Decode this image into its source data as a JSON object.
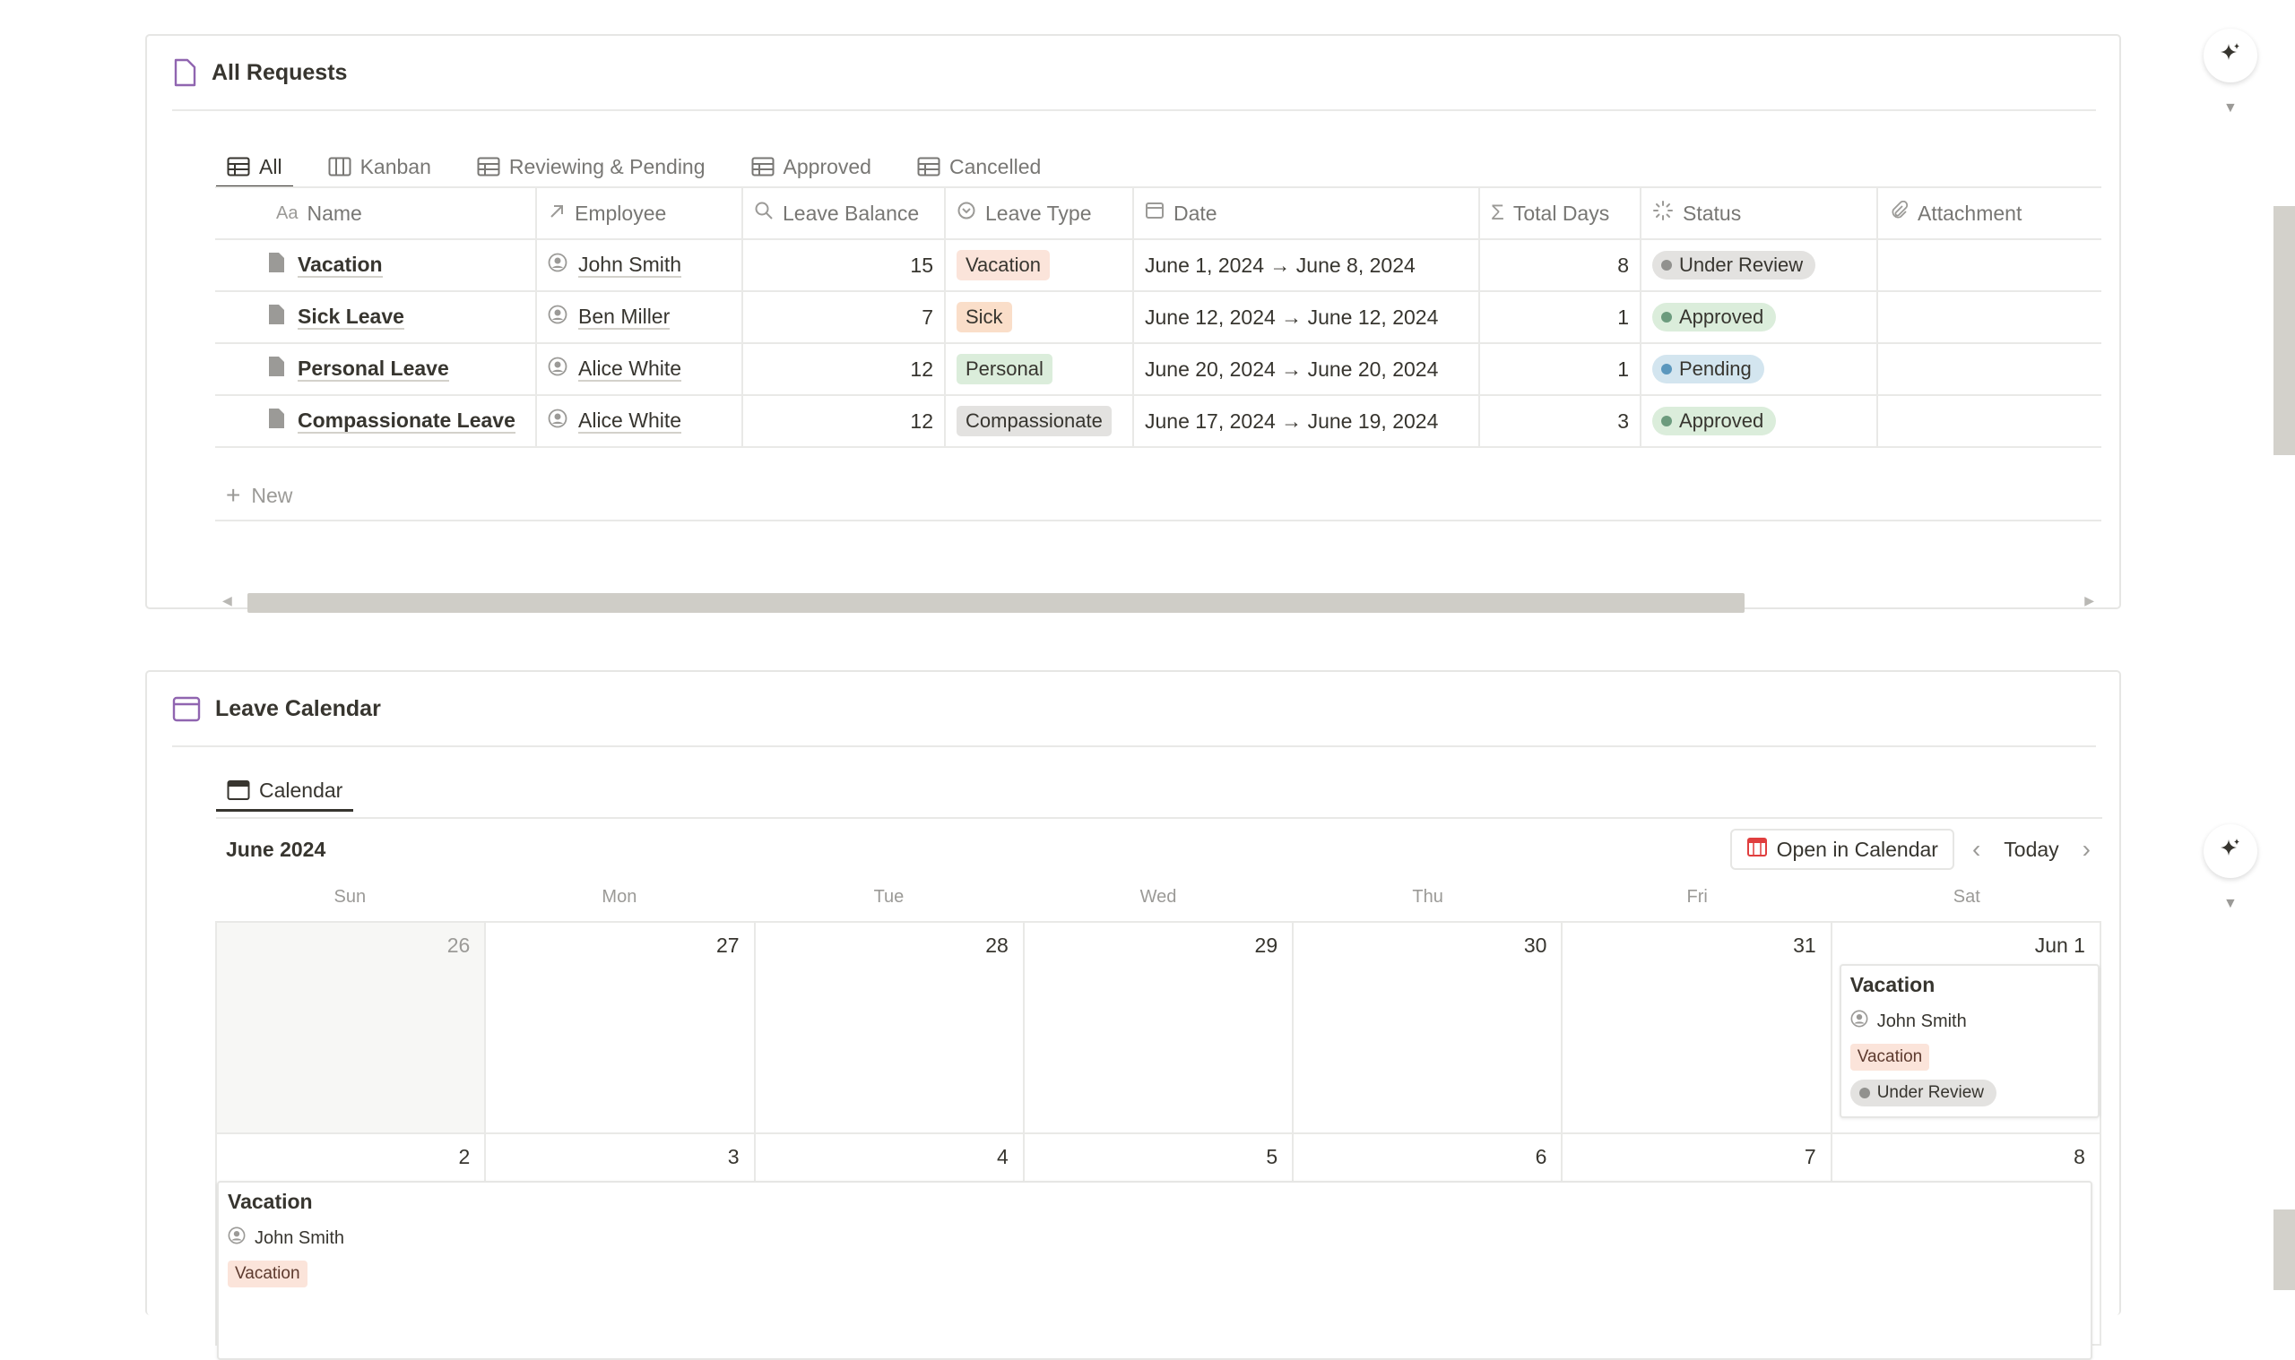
{
  "colors": {
    "tag_vacation": "#fbe4da",
    "tag_sick": "#fadec9",
    "tag_personal": "#dbeddb",
    "tag_compassionate": "#e3e2e0",
    "status_review_bg": "#e3e2e0",
    "status_review_dot": "#91918e",
    "status_approved_bg": "#dbeddb",
    "status_approved_dot": "#6c9b7d",
    "status_pending_bg": "#d3e5ef",
    "status_pending_dot": "#5b97bd",
    "calendar_icon_red": "#e03e3e",
    "section_icon_purple": "#9065b0"
  },
  "all_requests": {
    "title": "All Requests",
    "icon": "page-icon",
    "tabs": [
      {
        "label": "All",
        "icon": "table-icon",
        "active": true
      },
      {
        "label": "Kanban",
        "icon": "board-icon"
      },
      {
        "label": "Reviewing & Pending",
        "icon": "table-icon"
      },
      {
        "label": "Approved",
        "icon": "table-icon"
      },
      {
        "label": "Cancelled",
        "icon": "table-icon"
      }
    ],
    "columns": [
      {
        "label": "Name",
        "icon": "text-aa-icon"
      },
      {
        "label": "Employee",
        "icon": "relation-arrow-icon"
      },
      {
        "label": "Leave Balance",
        "icon": "search-icon"
      },
      {
        "label": "Leave Type",
        "icon": "select-icon"
      },
      {
        "label": "Date",
        "icon": "calendar-icon"
      },
      {
        "label": "Total Days",
        "icon": "sigma-icon"
      },
      {
        "label": "Status",
        "icon": "status-icon"
      },
      {
        "label": "Attachment",
        "icon": "paperclip-icon"
      }
    ],
    "rows": [
      {
        "name": "Vacation",
        "employee": "John Smith",
        "balance": "15",
        "type": "Vacation",
        "date": "June 1, 2024 → June 8, 2024",
        "days": "8",
        "status": "Under Review"
      },
      {
        "name": "Sick Leave",
        "employee": "Ben Miller",
        "balance": "7",
        "type": "Sick",
        "date": "June 12, 2024 → June 12, 2024",
        "days": "1",
        "status": "Approved"
      },
      {
        "name": "Personal Leave",
        "employee": "Alice White",
        "balance": "12",
        "type": "Personal",
        "date": "June 20, 2024 → June 20, 2024",
        "days": "1",
        "status": "Pending"
      },
      {
        "name": "Compassionate Leave",
        "employee": "Alice White",
        "balance": "12",
        "type": "Compassionate",
        "date": "June 17, 2024 → June 19, 2024",
        "days": "3",
        "status": "Approved"
      }
    ],
    "new_label": "New"
  },
  "leave_calendar": {
    "title": "Leave Calendar",
    "view_tab": "Calendar",
    "month": "June 2024",
    "open_in_calendar": "Open in Calendar",
    "today": "Today",
    "weekdays": [
      "Sun",
      "Mon",
      "Tue",
      "Wed",
      "Thu",
      "Fri",
      "Sat"
    ],
    "week1": [
      "26",
      "27",
      "28",
      "29",
      "30",
      "31",
      "Jun 1"
    ],
    "week2": [
      "2",
      "3",
      "4",
      "5",
      "6",
      "7",
      "8"
    ],
    "event1": {
      "title": "Vacation",
      "person": "John Smith",
      "tag": "Vacation",
      "status": "Under Review"
    },
    "event2": {
      "title": "Vacation",
      "person": "John Smith",
      "tag": "Vacation"
    }
  }
}
